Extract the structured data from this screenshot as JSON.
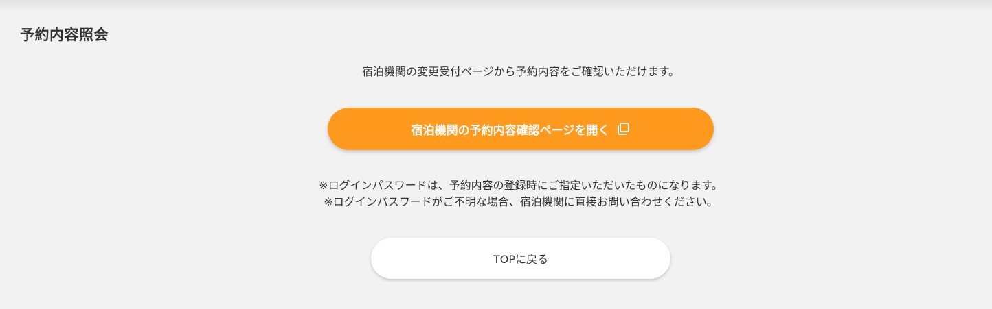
{
  "page": {
    "title": "予約内容照会"
  },
  "main": {
    "intro_text": "宿泊機関の変更受付ページから予約内容をご確認いただけます。",
    "open_button_label": "宿泊機関の予約内容確認ページを開く",
    "open_button_icon": "copy-icon",
    "notes": [
      "※ログインパスワードは、予約内容の登録時にご指定いただいたものになります。",
      "※ログインパスワードがご不明な場合、宿泊機関に直接お問い合わせください。"
    ],
    "back_button_label": "TOPに戻る"
  },
  "colors": {
    "background": "#f2f2f2",
    "accent": "#ff9a1f",
    "text": "#333333",
    "button_secondary": "#ffffff"
  }
}
